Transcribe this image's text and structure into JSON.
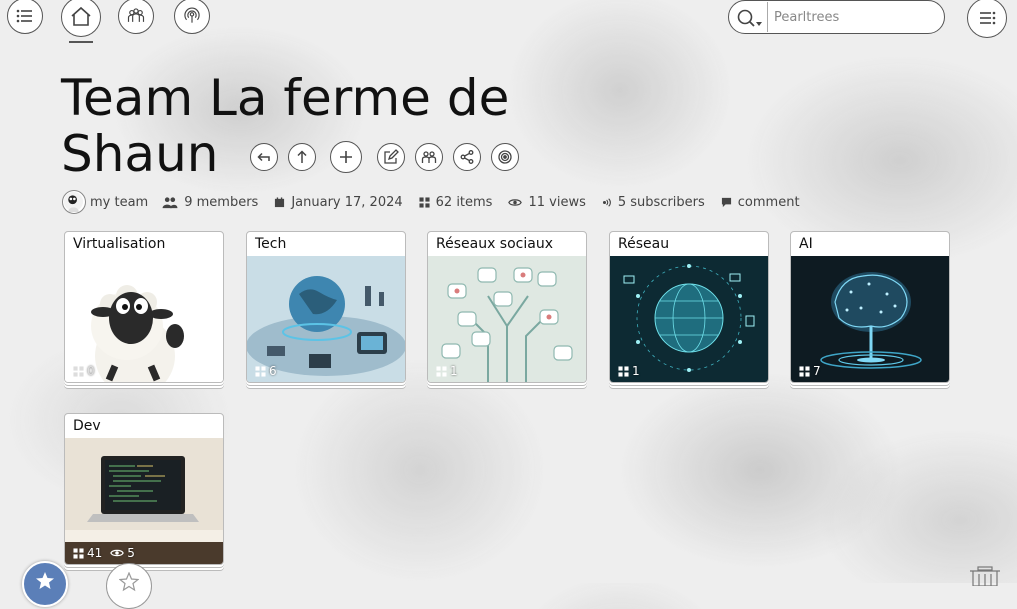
{
  "nav": {
    "menu_icon": "list-icon",
    "home_icon": "home-icon",
    "teams_icon": "team-icon",
    "broadcast_icon": "broadcast-icon",
    "settings_icon": "settings-menu-icon"
  },
  "search": {
    "placeholder": "Pearltrees",
    "icon": "search-icon"
  },
  "header": {
    "title": "Team La ferme de Shaun"
  },
  "actions": [
    "back-icon",
    "up-icon",
    "add-icon",
    "edit-icon",
    "team-icon",
    "share-icon",
    "target-icon"
  ],
  "meta": {
    "owner": "my team",
    "members": "9 members",
    "date": "January 17, 2024",
    "items": "62 items",
    "views": "11 views",
    "subscribers": "5 subscribers",
    "comment": "comment"
  },
  "cards": [
    {
      "title": "Virtualisation",
      "count": "0"
    },
    {
      "title": "Tech",
      "count": "6"
    },
    {
      "title": "Réseaux sociaux",
      "count": "1"
    },
    {
      "title": "Réseau",
      "count": "1"
    },
    {
      "title": "AI",
      "count": "7"
    },
    {
      "title": "Dev",
      "count": "41",
      "views": "5"
    }
  ],
  "colors": {
    "accent_blue": "#5b7fb8",
    "card_tech": "#4a90b8",
    "card_ai": "#1a3a4a"
  }
}
